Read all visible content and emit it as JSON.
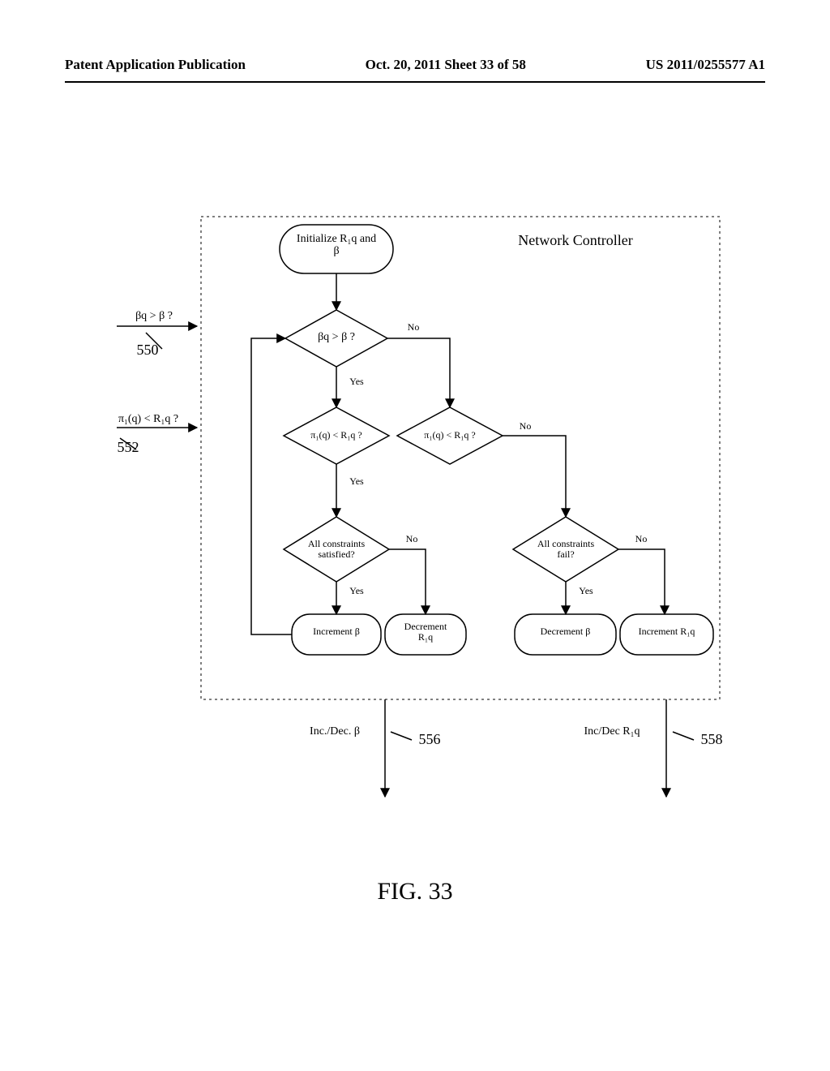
{
  "header": {
    "left": "Patent Application Publication",
    "center": "Oct. 20, 2011  Sheet 33 of 58",
    "right": "US 2011/0255577 A1"
  },
  "title": "Network Controller",
  "nodes": {
    "init": "Initialize R₁q and\nβ",
    "d_beta": "βq > β ?",
    "d_pi_left": "π₁(q) < R₁q ?",
    "d_pi_right": "π₁(q) < R₁q ?",
    "d_sat": "All constraints\nsatisfied?",
    "d_fail": "All constraints\nfail?",
    "a_incb": "Increment β",
    "a_decR": "Decrement\nR₁q",
    "a_decb": "Decrement β",
    "a_incR": "Increment R₁q"
  },
  "edges": {
    "no": "No",
    "yes": "Yes"
  },
  "inputs": {
    "in550": {
      "text": "βq > β ?",
      "ref": "550"
    },
    "in552": {
      "text": "π₁(q) < R₁q ?",
      "ref": "552"
    }
  },
  "outputs": {
    "out556": {
      "text": "Inc./Dec. β",
      "ref": "556"
    },
    "out558": {
      "text": "Inc/Dec R₁q",
      "ref": "558"
    }
  },
  "figure": "FIG. 33"
}
